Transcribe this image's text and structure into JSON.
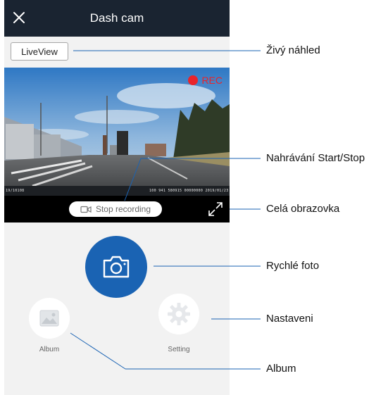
{
  "header": {
    "title": "Dash cam",
    "close_icon": "close-icon"
  },
  "toolbar": {
    "liveview_label": "LiveView"
  },
  "video": {
    "rec_label": "REC",
    "osd_left": "19/10108",
    "osd_right": "100 941 580915 00000000 2019/01/23"
  },
  "controls": {
    "stop_recording_label": "Stop recording",
    "video_icon": "video-camera-icon",
    "fullscreen_icon": "fullscreen-expand-icon"
  },
  "actions": {
    "photo_icon": "camera-icon",
    "album_label": "Album",
    "album_icon": "image-icon",
    "setting_label": "Setting",
    "setting_icon": "gear-icon"
  },
  "callouts": {
    "live_preview": "Živý náhled",
    "record": "Nahrávání Start/Stop",
    "fullscreen": "Celá obrazovka",
    "quick_photo": "Rychlé foto",
    "settings": "Nastaveni",
    "album": "Album"
  },
  "colors": {
    "titlebar": "#1a2431",
    "accent_blue": "#1a63b3",
    "rec_red": "#e9242b",
    "callout_line": "#1a63b3"
  }
}
